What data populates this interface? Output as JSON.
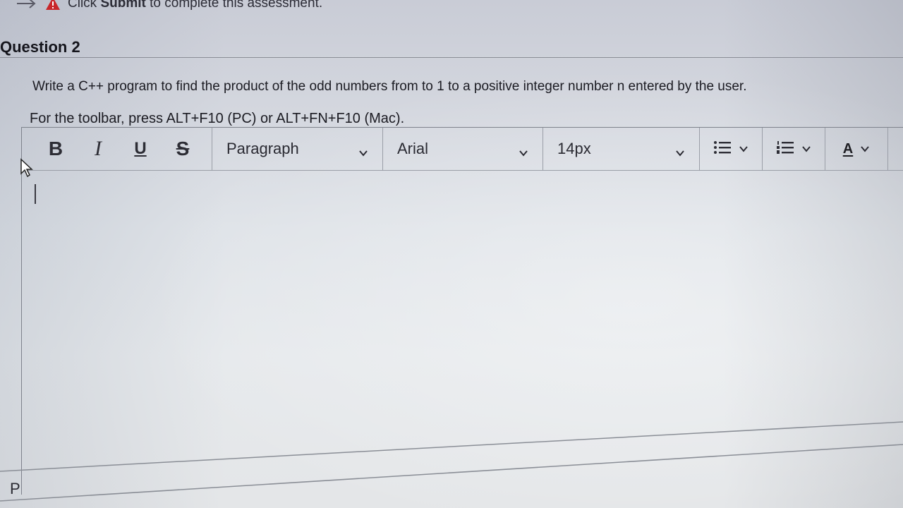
{
  "notice": {
    "prefix": "Click",
    "bold": "Submit",
    "suffix": "to complete this assessment."
  },
  "question": {
    "title": "Question 2",
    "prompt": "Write a C++ program to find the product of the odd numbers from to 1 to a positive integer number n entered by the user.",
    "toolbar_hint": "For the toolbar, press ALT+F10 (PC) or ALT+FN+F10 (Mac)."
  },
  "toolbar": {
    "bold": "B",
    "italic": "I",
    "underline": "U",
    "strike": "S",
    "block_format": "Paragraph",
    "font_family": "Arial",
    "font_size": "14px",
    "text_color": "A"
  },
  "status_bar": {
    "path": "P"
  },
  "icons": {
    "notice_arrow": "arrow-right-icon",
    "warning": "warning-icon",
    "bullet_list": "bullet-list-icon",
    "numbered_list": "numbered-list-icon",
    "font_color": "font-color-icon",
    "pointer": "mouse-pointer-icon"
  },
  "colors": {
    "warning": "#c8262a",
    "font_color_underline": "#2b2b33"
  }
}
